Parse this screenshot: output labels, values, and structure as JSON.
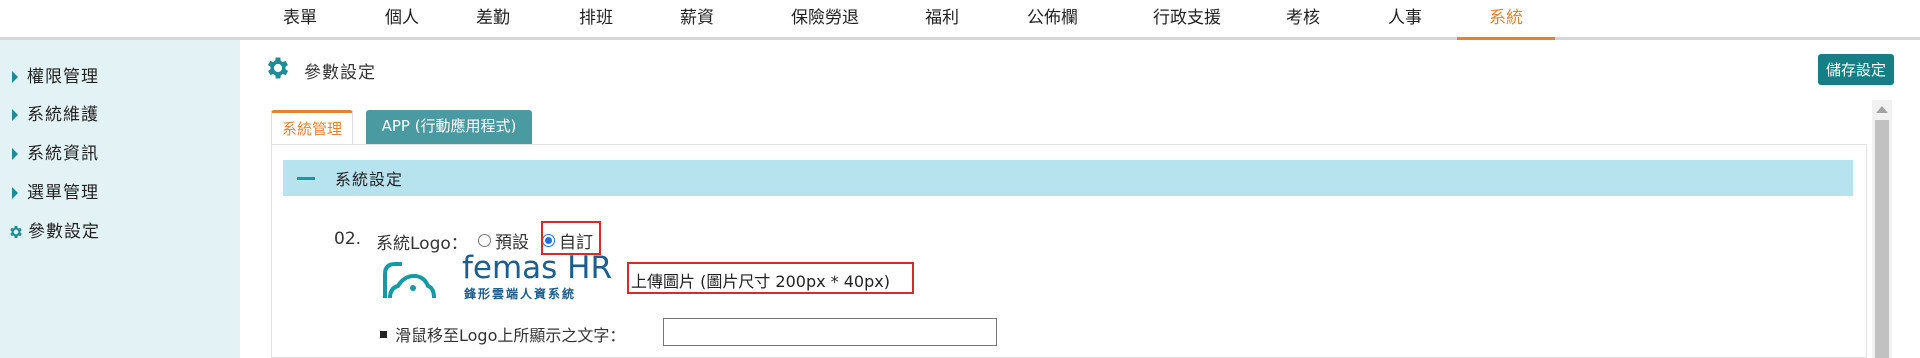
{
  "topnav": {
    "items": [
      "表單",
      "個人",
      "差勤",
      "排班",
      "薪資",
      "保險勞退",
      "福利",
      "公佈欄",
      "行政支援",
      "考核",
      "人事",
      "系統"
    ],
    "active_index": 11,
    "active_color": "#e8822a"
  },
  "sidebar": {
    "items": [
      {
        "label": "權限管理",
        "icon": "caret-right-icon"
      },
      {
        "label": "系統維護",
        "icon": "caret-right-icon"
      },
      {
        "label": "系統資訊",
        "icon": "caret-right-icon"
      },
      {
        "label": "選單管理",
        "icon": "caret-right-icon"
      },
      {
        "label": "參數設定",
        "icon": "gear-icon"
      }
    ]
  },
  "header": {
    "title": "參數設定",
    "icon": "gear-icon",
    "save_label": "儲存設定"
  },
  "tabs": [
    {
      "label": "系統管理",
      "active": true
    },
    {
      "label": "APP (行動應用程式)",
      "active": false
    }
  ],
  "section": {
    "title": "系統設定"
  },
  "logo_setting": {
    "number": "02.",
    "label": "系統Logo：",
    "options": [
      {
        "label": "預設",
        "checked": false
      },
      {
        "label": "自訂",
        "checked": true
      }
    ],
    "logo_brand": "femas HR",
    "logo_subtitle": "鋒形雲端人資系統",
    "upload_text": "上傳圖片 (圖片尺寸 200px * 40px)",
    "hover_label": "滑鼠移至Logo上所顯示之文字：",
    "hover_value": ""
  },
  "colors": {
    "accent": "#e8822a",
    "teal": "#167f86",
    "sidebar_bg": "#e3f2f4",
    "section_bg": "#b7e3ef"
  }
}
